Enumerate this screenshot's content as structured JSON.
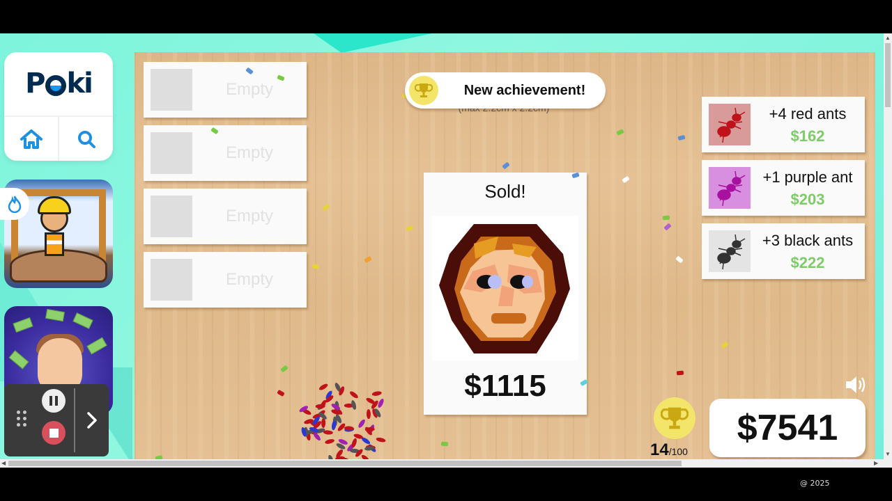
{
  "poki": {
    "logo_text": "Poki",
    "home_icon": "home-icon",
    "search_icon": "search-icon",
    "hot_badge_icon": "flame-icon",
    "game_thumbnails": [
      {
        "name": "miner-game-thumbnail"
      },
      {
        "name": "money-game-thumbnail"
      }
    ]
  },
  "recorder": {
    "grip_icon": "drag-handle-icon",
    "pause_icon": "pause-icon",
    "stop_icon": "stop-icon",
    "expand_icon": "chevron-right-icon"
  },
  "slots": [
    {
      "label": "Empty"
    },
    {
      "label": "Empty"
    },
    {
      "label": "Empty"
    },
    {
      "label": "Empty"
    }
  ],
  "achievement_toast": {
    "icon": "trophy-icon",
    "text": "New achievement!"
  },
  "size_hint": "(max 2.2cm x 2.2cm)",
  "sold_card": {
    "title": "Sold!",
    "artwork": "ant-portrait-face",
    "price": "$1115"
  },
  "offers": [
    {
      "name": "+4 red ants",
      "price": "$162",
      "color": "#c0121a",
      "bg": "#d99a9a"
    },
    {
      "name": "+1 purple ant",
      "price": "$203",
      "color": "#b514c0",
      "bg": "#d98fe0"
    },
    {
      "name": "+3 black ants",
      "price": "$222",
      "color": "#333333",
      "bg": "#e4e4e4"
    }
  ],
  "achievements": {
    "current": "14",
    "total": "/100"
  },
  "money": "$7541",
  "sound_icon": "speaker-icon",
  "footer": {
    "copyright": "@ 2025"
  },
  "colors": {
    "price_green": "#7ecb6a",
    "trophy_yellow": "#f3e56a",
    "poki_navy": "#002b50",
    "poki_blue": "#1e90e0"
  }
}
